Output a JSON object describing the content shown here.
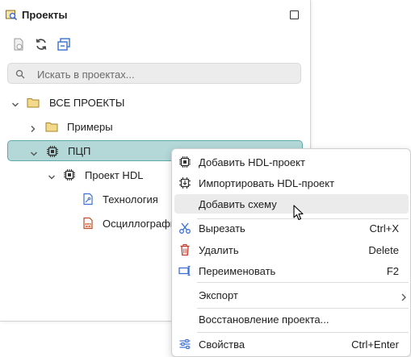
{
  "panel": {
    "title": "Проекты",
    "search_placeholder": "Искать в проектах..."
  },
  "tree": {
    "root_label": "ВСЕ ПРОЕКТЫ",
    "examples_label": "Примеры",
    "selected_label": "ПЦП",
    "hdl_label": "Проект HDL",
    "tech_label": "Технология",
    "osc_label": "Осциллографы"
  },
  "menu": {
    "add_hdl": "Добавить HDL-проект",
    "import_hdl": "Импортировать HDL-проект",
    "add_scheme": "Добавить схему",
    "cut": "Вырезать",
    "cut_shortcut": "Ctrl+X",
    "delete": "Удалить",
    "delete_shortcut": "Delete",
    "rename": "Переименовать",
    "rename_shortcut": "F2",
    "export": "Экспорт",
    "restore": "Восстановление проекта...",
    "properties": "Свойства",
    "properties_shortcut": "Ctrl+Enter"
  },
  "colors": {
    "selection_fill": "#b4d8d8",
    "selection_border": "#5fa9a9",
    "folder": "#e9c46a",
    "accent_blue": "#3b6fd4",
    "danger_red": "#c0392b"
  }
}
